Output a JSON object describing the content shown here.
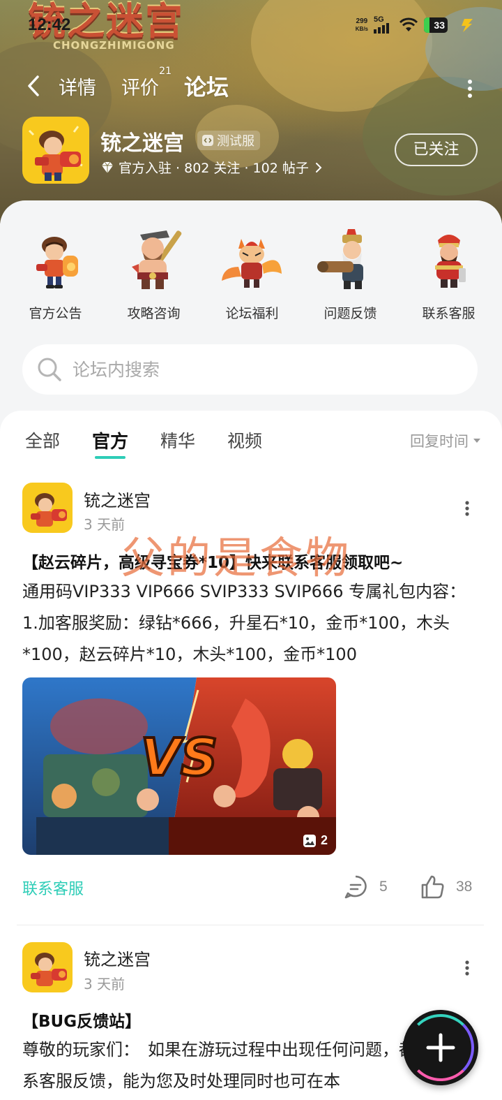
{
  "status_bar": {
    "time": "12:42",
    "net_speed_value": "299",
    "net_speed_unit": "KB/s",
    "network": "5G",
    "battery": "33"
  },
  "banner": {
    "logo_cn": "铳之迷宫",
    "logo_en": "CHONGZHIMIGONG"
  },
  "nav": {
    "tabs": [
      {
        "label": "详情"
      },
      {
        "label": "评价",
        "badge": "21"
      },
      {
        "label": "论坛"
      }
    ],
    "active_tab": "论坛"
  },
  "game": {
    "name": "铳之迷宫",
    "badge": "测试服",
    "meta": "官方入驻 · 802 关注 · 102 帖子",
    "follow_label": "已关注"
  },
  "quick_links": [
    {
      "label": "官方公告",
      "icon": "gunner-hero-icon"
    },
    {
      "label": "攻略咨询",
      "icon": "warrior-hero-icon"
    },
    {
      "label": "论坛福利",
      "icon": "fox-mage-icon"
    },
    {
      "label": "问题反馈",
      "icon": "cannon-dwarf-icon"
    },
    {
      "label": "联系客服",
      "icon": "general-hero-icon"
    }
  ],
  "search": {
    "placeholder": "论坛内搜索"
  },
  "filters": {
    "tabs": [
      "全部",
      "官方",
      "精华",
      "视频"
    ],
    "active": "官方",
    "sort_label": "回复时间"
  },
  "posts": [
    {
      "author": "铳之迷宫",
      "time": "3 天前",
      "title": "【赵云碎片，高级寻宝券*10】快来联系客服领取吧~",
      "body": "通用码VIP333 VIP666 SVIP333 SVIP666 专属礼包内容：1.加客服奖励：绿钻*666，升星石*10，金币*100，木头*100，赵云碎片*10，木头*100，金币*100",
      "image_count": "2",
      "image_text": "VS",
      "tag": "联系客服",
      "comments": "5",
      "likes": "38"
    },
    {
      "author": "铳之迷宫",
      "time": "3 天前",
      "title": "【BUG反馈站】",
      "body": "尊敬的玩家们：　如果在游玩过程中出现任何问题，都建议联系客服反馈，能为您及时处理同时也可在本"
    }
  ],
  "watermark": "父的是食物",
  "colors": {
    "accent": "#2ecdb7",
    "banner": "#7d7444",
    "sheet_bg": "#f4f5f6",
    "watermark": "#e86e3c"
  }
}
